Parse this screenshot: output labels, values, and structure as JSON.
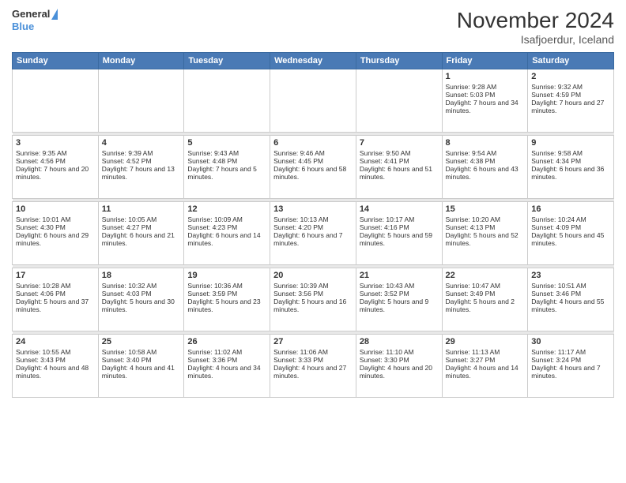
{
  "header": {
    "logo_line1": "General",
    "logo_line2": "Blue",
    "title": "November 2024",
    "subtitle": "Isafjoerdur, Iceland"
  },
  "calendar": {
    "days_of_week": [
      "Sunday",
      "Monday",
      "Tuesday",
      "Wednesday",
      "Thursday",
      "Friday",
      "Saturday"
    ],
    "weeks": [
      {
        "days": [
          {
            "num": "",
            "info": ""
          },
          {
            "num": "",
            "info": ""
          },
          {
            "num": "",
            "info": ""
          },
          {
            "num": "",
            "info": ""
          },
          {
            "num": "",
            "info": ""
          },
          {
            "num": "1",
            "info": "Sunrise: 9:28 AM\nSunset: 5:03 PM\nDaylight: 7 hours and 34 minutes."
          },
          {
            "num": "2",
            "info": "Sunrise: 9:32 AM\nSunset: 4:59 PM\nDaylight: 7 hours and 27 minutes."
          }
        ]
      },
      {
        "days": [
          {
            "num": "3",
            "info": "Sunrise: 9:35 AM\nSunset: 4:56 PM\nDaylight: 7 hours and 20 minutes."
          },
          {
            "num": "4",
            "info": "Sunrise: 9:39 AM\nSunset: 4:52 PM\nDaylight: 7 hours and 13 minutes."
          },
          {
            "num": "5",
            "info": "Sunrise: 9:43 AM\nSunset: 4:48 PM\nDaylight: 7 hours and 5 minutes."
          },
          {
            "num": "6",
            "info": "Sunrise: 9:46 AM\nSunset: 4:45 PM\nDaylight: 6 hours and 58 minutes."
          },
          {
            "num": "7",
            "info": "Sunrise: 9:50 AM\nSunset: 4:41 PM\nDaylight: 6 hours and 51 minutes."
          },
          {
            "num": "8",
            "info": "Sunrise: 9:54 AM\nSunset: 4:38 PM\nDaylight: 6 hours and 43 minutes."
          },
          {
            "num": "9",
            "info": "Sunrise: 9:58 AM\nSunset: 4:34 PM\nDaylight: 6 hours and 36 minutes."
          }
        ]
      },
      {
        "days": [
          {
            "num": "10",
            "info": "Sunrise: 10:01 AM\nSunset: 4:30 PM\nDaylight: 6 hours and 29 minutes."
          },
          {
            "num": "11",
            "info": "Sunrise: 10:05 AM\nSunset: 4:27 PM\nDaylight: 6 hours and 21 minutes."
          },
          {
            "num": "12",
            "info": "Sunrise: 10:09 AM\nSunset: 4:23 PM\nDaylight: 6 hours and 14 minutes."
          },
          {
            "num": "13",
            "info": "Sunrise: 10:13 AM\nSunset: 4:20 PM\nDaylight: 6 hours and 7 minutes."
          },
          {
            "num": "14",
            "info": "Sunrise: 10:17 AM\nSunset: 4:16 PM\nDaylight: 5 hours and 59 minutes."
          },
          {
            "num": "15",
            "info": "Sunrise: 10:20 AM\nSunset: 4:13 PM\nDaylight: 5 hours and 52 minutes."
          },
          {
            "num": "16",
            "info": "Sunrise: 10:24 AM\nSunset: 4:09 PM\nDaylight: 5 hours and 45 minutes."
          }
        ]
      },
      {
        "days": [
          {
            "num": "17",
            "info": "Sunrise: 10:28 AM\nSunset: 4:06 PM\nDaylight: 5 hours and 37 minutes."
          },
          {
            "num": "18",
            "info": "Sunrise: 10:32 AM\nSunset: 4:03 PM\nDaylight: 5 hours and 30 minutes."
          },
          {
            "num": "19",
            "info": "Sunrise: 10:36 AM\nSunset: 3:59 PM\nDaylight: 5 hours and 23 minutes."
          },
          {
            "num": "20",
            "info": "Sunrise: 10:39 AM\nSunset: 3:56 PM\nDaylight: 5 hours and 16 minutes."
          },
          {
            "num": "21",
            "info": "Sunrise: 10:43 AM\nSunset: 3:52 PM\nDaylight: 5 hours and 9 minutes."
          },
          {
            "num": "22",
            "info": "Sunrise: 10:47 AM\nSunset: 3:49 PM\nDaylight: 5 hours and 2 minutes."
          },
          {
            "num": "23",
            "info": "Sunrise: 10:51 AM\nSunset: 3:46 PM\nDaylight: 4 hours and 55 minutes."
          }
        ]
      },
      {
        "days": [
          {
            "num": "24",
            "info": "Sunrise: 10:55 AM\nSunset: 3:43 PM\nDaylight: 4 hours and 48 minutes."
          },
          {
            "num": "25",
            "info": "Sunrise: 10:58 AM\nSunset: 3:40 PM\nDaylight: 4 hours and 41 minutes."
          },
          {
            "num": "26",
            "info": "Sunrise: 11:02 AM\nSunset: 3:36 PM\nDaylight: 4 hours and 34 minutes."
          },
          {
            "num": "27",
            "info": "Sunrise: 11:06 AM\nSunset: 3:33 PM\nDaylight: 4 hours and 27 minutes."
          },
          {
            "num": "28",
            "info": "Sunrise: 11:10 AM\nSunset: 3:30 PM\nDaylight: 4 hours and 20 minutes."
          },
          {
            "num": "29",
            "info": "Sunrise: 11:13 AM\nSunset: 3:27 PM\nDaylight: 4 hours and 14 minutes."
          },
          {
            "num": "30",
            "info": "Sunrise: 11:17 AM\nSunset: 3:24 PM\nDaylight: 4 hours and 7 minutes."
          }
        ]
      }
    ]
  }
}
